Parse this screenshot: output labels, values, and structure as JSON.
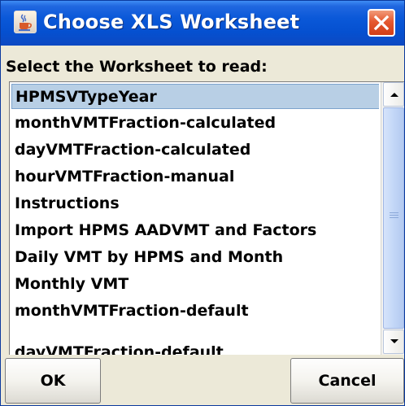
{
  "window": {
    "title": "Choose XLS Worksheet",
    "icon": "java-cup-icon",
    "close_icon": "close-icon"
  },
  "prompt": "Select the Worksheet to read:",
  "worksheets": [
    "HPMSVTypeYear",
    "monthVMTFraction-calculated",
    "dayVMTFraction-calculated",
    "hourVMTFraction-manual",
    "Instructions",
    "Import HPMS AADVMT and Factors",
    "Daily VMT by HPMS and Month",
    "Monthly VMT",
    "monthVMTFraction-default",
    "dayVMTFraction-default"
  ],
  "selected_index": 0,
  "scrollbar": {
    "position_fraction": 0.0
  },
  "buttons": {
    "ok": "OK",
    "cancel": "Cancel"
  },
  "colors": {
    "titlebar": "#0a58d8",
    "selection": "#b8cfe5",
    "close_button": "#e5582f"
  }
}
